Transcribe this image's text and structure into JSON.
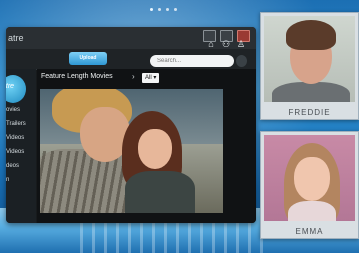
{
  "pager": {
    "count": 4,
    "active": 0
  },
  "app": {
    "title": "atre",
    "upload_label": "Upload",
    "search_placeholder": "Search...",
    "logo_text": "atre"
  },
  "sidebar": {
    "items": [
      {
        "label": "ovies"
      },
      {
        "label": "Trailers"
      },
      {
        "label": "Videos"
      },
      {
        "label": "Videos"
      },
      {
        "label": "deos"
      },
      {
        "label": "n"
      }
    ]
  },
  "main": {
    "breadcrumb": "Feature Length Movies",
    "arrow": "›",
    "filter": "All ▾"
  },
  "video_chat": {
    "participants": [
      {
        "name": "FREDDIE"
      },
      {
        "name": "EMMA"
      }
    ]
  }
}
